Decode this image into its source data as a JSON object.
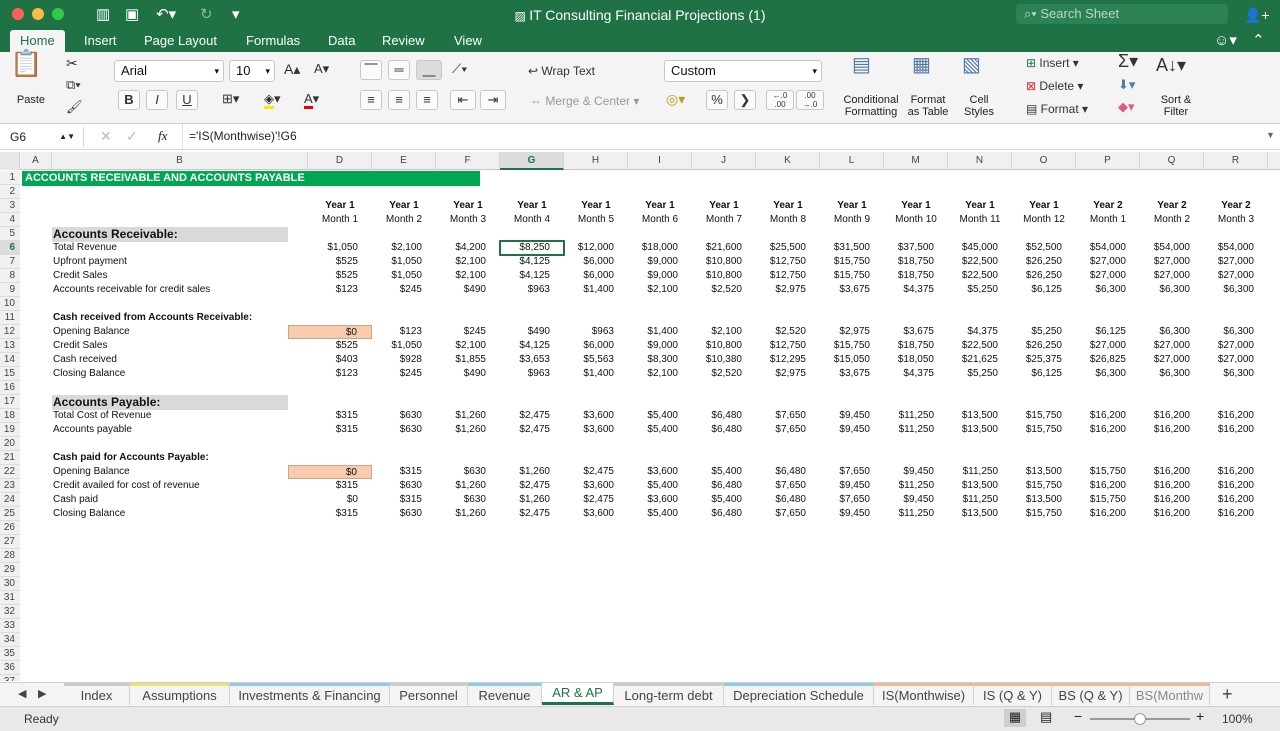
{
  "window": {
    "title": "IT Consulting Financial Projections (1)",
    "search_placeholder": "Search Sheet"
  },
  "ribbon_tabs": [
    "Home",
    "Insert",
    "Page Layout",
    "Formulas",
    "Data",
    "Review",
    "View"
  ],
  "ribbon": {
    "paste": "Paste",
    "font": "Arial",
    "size": "10",
    "bold": "B",
    "italic": "I",
    "underline": "U",
    "wrap": "Wrap Text",
    "merge": "Merge & Center",
    "numfmt": "Custom",
    "pct": "%",
    "comma": "❯",
    "inc_dec": "←.0\n.00",
    "dec_dec": ".00\n→.0",
    "cond1": "Conditional",
    "cond2": "Formatting",
    "fmt1": "Format",
    "fmt2": "as Table",
    "cs1": "Cell",
    "cs2": "Styles",
    "insert": "Insert",
    "delete": "Delete",
    "format": "Format",
    "sort1": "Sort &",
    "sort2": "Filter"
  },
  "formula": {
    "namebox": "G6",
    "fx": "fx",
    "text": "='IS(Monthwise)'!G6"
  },
  "columns": [
    "A",
    "B",
    "D",
    "E",
    "F",
    "G",
    "H",
    "I",
    "J",
    "K",
    "L",
    "M",
    "N",
    "O",
    "P",
    "Q",
    "R",
    "S"
  ],
  "selected_col": "G",
  "selected_row": 6,
  "sheet": {
    "title": "ACCOUNTS RECEIVABLE AND ACCOUNTS PAYABLE",
    "years": [
      "Year 1",
      "Year 1",
      "Year 1",
      "Year 1",
      "Year 1",
      "Year 1",
      "Year 1",
      "Year 1",
      "Year 1",
      "Year 1",
      "Year 1",
      "Year 1",
      "Year 2",
      "Year 2",
      "Year 2",
      "Yea"
    ],
    "months": [
      "Month 1",
      "Month 2",
      "Month 3",
      "Month 4",
      "Month 5",
      "Month 6",
      "Month 7",
      "Month 8",
      "Month 9",
      "Month 10",
      "Month 11",
      "Month 12",
      "Month 1",
      "Month 2",
      "Month 3",
      "Mon"
    ],
    "labels": {
      "5": "Accounts Receivable:",
      "6": "Total Revenue",
      "7": "Upfront payment",
      "8": "Credit Sales",
      "9": "Accounts receivable for credit sales",
      "11": "Cash received from Accounts Receivable:",
      "12": "Opening Balance",
      "13": "Credit Sales",
      "14": "Cash received",
      "15": "Closing Balance",
      "17": "Accounts Payable:",
      "18": "Total Cost of Revenue",
      "19": "Accounts payable",
      "21": "Cash paid for Accounts Payable:",
      "22": "Opening Balance",
      "23": "Credit availed for cost of revenue",
      "24": "Cash paid",
      "25": "Closing Balance"
    },
    "values": {
      "6": [
        "$1,050",
        "$2,100",
        "$4,200",
        "$8,250",
        "$12,000",
        "$18,000",
        "$21,600",
        "$25,500",
        "$31,500",
        "$37,500",
        "$45,000",
        "$52,500",
        "$54,000",
        "$54,000",
        "$54,000",
        "$5"
      ],
      "7": [
        "$525",
        "$1,050",
        "$2,100",
        "$4,125",
        "$6,000",
        "$9,000",
        "$10,800",
        "$12,750",
        "$15,750",
        "$18,750",
        "$22,500",
        "$26,250",
        "$27,000",
        "$27,000",
        "$27,000",
        "$2"
      ],
      "8": [
        "$525",
        "$1,050",
        "$2,100",
        "$4,125",
        "$6,000",
        "$9,000",
        "$10,800",
        "$12,750",
        "$15,750",
        "$18,750",
        "$22,500",
        "$26,250",
        "$27,000",
        "$27,000",
        "$27,000",
        "$2"
      ],
      "9": [
        "$123",
        "$245",
        "$490",
        "$963",
        "$1,400",
        "$2,100",
        "$2,520",
        "$2,975",
        "$3,675",
        "$4,375",
        "$5,250",
        "$6,125",
        "$6,300",
        "$6,300",
        "$6,300",
        "$"
      ],
      "12": [
        "$0",
        "$123",
        "$245",
        "$490",
        "$963",
        "$1,400",
        "$2,100",
        "$2,520",
        "$2,975",
        "$3,675",
        "$4,375",
        "$5,250",
        "$6,125",
        "$6,300",
        "$6,300",
        "$"
      ],
      "13": [
        "$525",
        "$1,050",
        "$2,100",
        "$4,125",
        "$6,000",
        "$9,000",
        "$10,800",
        "$12,750",
        "$15,750",
        "$18,750",
        "$22,500",
        "$26,250",
        "$27,000",
        "$27,000",
        "$27,000",
        "$2"
      ],
      "14": [
        "$403",
        "$928",
        "$1,855",
        "$3,653",
        "$5,563",
        "$8,300",
        "$10,380",
        "$12,295",
        "$15,050",
        "$18,050",
        "$21,625",
        "$25,375",
        "$26,825",
        "$27,000",
        "$27,000",
        "$2"
      ],
      "15": [
        "$123",
        "$245",
        "$490",
        "$963",
        "$1,400",
        "$2,100",
        "$2,520",
        "$2,975",
        "$3,675",
        "$4,375",
        "$5,250",
        "$6,125",
        "$6,300",
        "$6,300",
        "$6,300",
        "$"
      ],
      "18": [
        "$315",
        "$630",
        "$1,260",
        "$2,475",
        "$3,600",
        "$5,400",
        "$6,480",
        "$7,650",
        "$9,450",
        "$11,250",
        "$13,500",
        "$15,750",
        "$16,200",
        "$16,200",
        "$16,200",
        "$1"
      ],
      "19": [
        "$315",
        "$630",
        "$1,260",
        "$2,475",
        "$3,600",
        "$5,400",
        "$6,480",
        "$7,650",
        "$9,450",
        "$11,250",
        "$13,500",
        "$15,750",
        "$16,200",
        "$16,200",
        "$16,200",
        "$1"
      ],
      "22": [
        "$0",
        "$315",
        "$630",
        "$1,260",
        "$2,475",
        "$3,600",
        "$5,400",
        "$6,480",
        "$7,650",
        "$9,450",
        "$11,250",
        "$13,500",
        "$15,750",
        "$16,200",
        "$16,200",
        "$1"
      ],
      "23": [
        "$315",
        "$630",
        "$1,260",
        "$2,475",
        "$3,600",
        "$5,400",
        "$6,480",
        "$7,650",
        "$9,450",
        "$11,250",
        "$13,500",
        "$15,750",
        "$16,200",
        "$16,200",
        "$16,200",
        "$1"
      ],
      "24": [
        "$0",
        "$315",
        "$630",
        "$1,260",
        "$2,475",
        "$3,600",
        "$5,400",
        "$6,480",
        "$7,650",
        "$9,450",
        "$11,250",
        "$13,500",
        "$15,750",
        "$16,200",
        "$16,200",
        "$1"
      ],
      "25": [
        "$315",
        "$630",
        "$1,260",
        "$2,475",
        "$3,600",
        "$5,400",
        "$6,480",
        "$7,650",
        "$9,450",
        "$11,250",
        "$13,500",
        "$15,750",
        "$16,200",
        "$16,200",
        "$16,200",
        "$1"
      ]
    }
  },
  "sheet_tabs": [
    "Index",
    "Assumptions",
    "Investments & Financing",
    "Personnel",
    "Revenue",
    "AR & AP",
    "Long-term debt",
    "Depreciation Schedule",
    "IS(Monthwise)",
    "IS (Q & Y)",
    "BS (Q & Y)",
    "BS(Monthw"
  ],
  "active_sheet": "AR & AP",
  "status": {
    "ready": "Ready",
    "zoom": "100%"
  },
  "colors": {
    "excel_green": "#1f7244",
    "title_fill": "#00a651",
    "section_fill": "#d9d9d9",
    "input_fill": "#f8cbad"
  }
}
